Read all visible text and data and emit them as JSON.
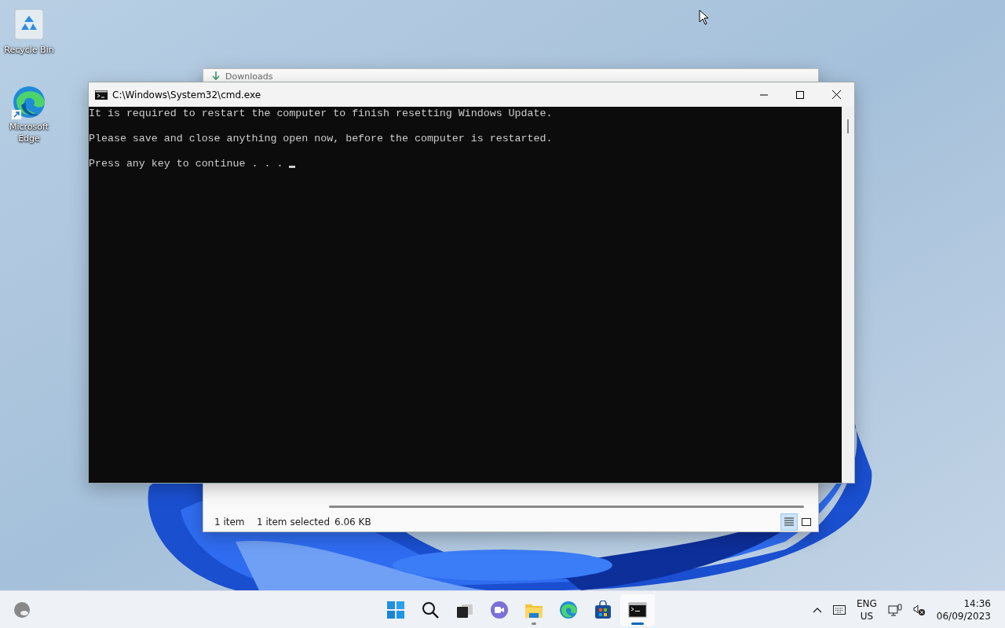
{
  "desktop_icons": [
    {
      "kind": "recycle-bin",
      "label": "Recycle Bin"
    },
    {
      "kind": "edge",
      "label": "Microsoft Edge"
    }
  ],
  "explorer_window": {
    "title": "Downloads",
    "status_bar": {
      "count": "1 item",
      "selection": "1 item selected",
      "size": "6.06 KB"
    },
    "views": [
      {
        "kind": "details",
        "selected": true
      },
      {
        "kind": "tiles",
        "selected": false
      }
    ]
  },
  "cmd_window": {
    "title": "C:\\Windows\\System32\\cmd.exe",
    "lines": [
      "It is required to restart the computer to finish resetting Windows Update.",
      "Please save and close anything open now, before the computer is restarted.",
      "Press any key to continue . . . "
    ],
    "cursor": true
  },
  "taskbar": {
    "apps": [
      {
        "kind": "start",
        "running": false,
        "active": false
      },
      {
        "kind": "search",
        "running": false,
        "active": false
      },
      {
        "kind": "task-view",
        "running": false,
        "active": false
      },
      {
        "kind": "chat",
        "running": false,
        "active": false
      },
      {
        "kind": "explorer",
        "running": true,
        "active": false
      },
      {
        "kind": "edge",
        "running": false,
        "active": false
      },
      {
        "kind": "store",
        "running": false,
        "active": false
      },
      {
        "kind": "terminal",
        "running": true,
        "active": true
      }
    ],
    "language": {
      "line1": "ENG",
      "line2": "US"
    },
    "time": "14:36",
    "date": "06/09/2023"
  }
}
